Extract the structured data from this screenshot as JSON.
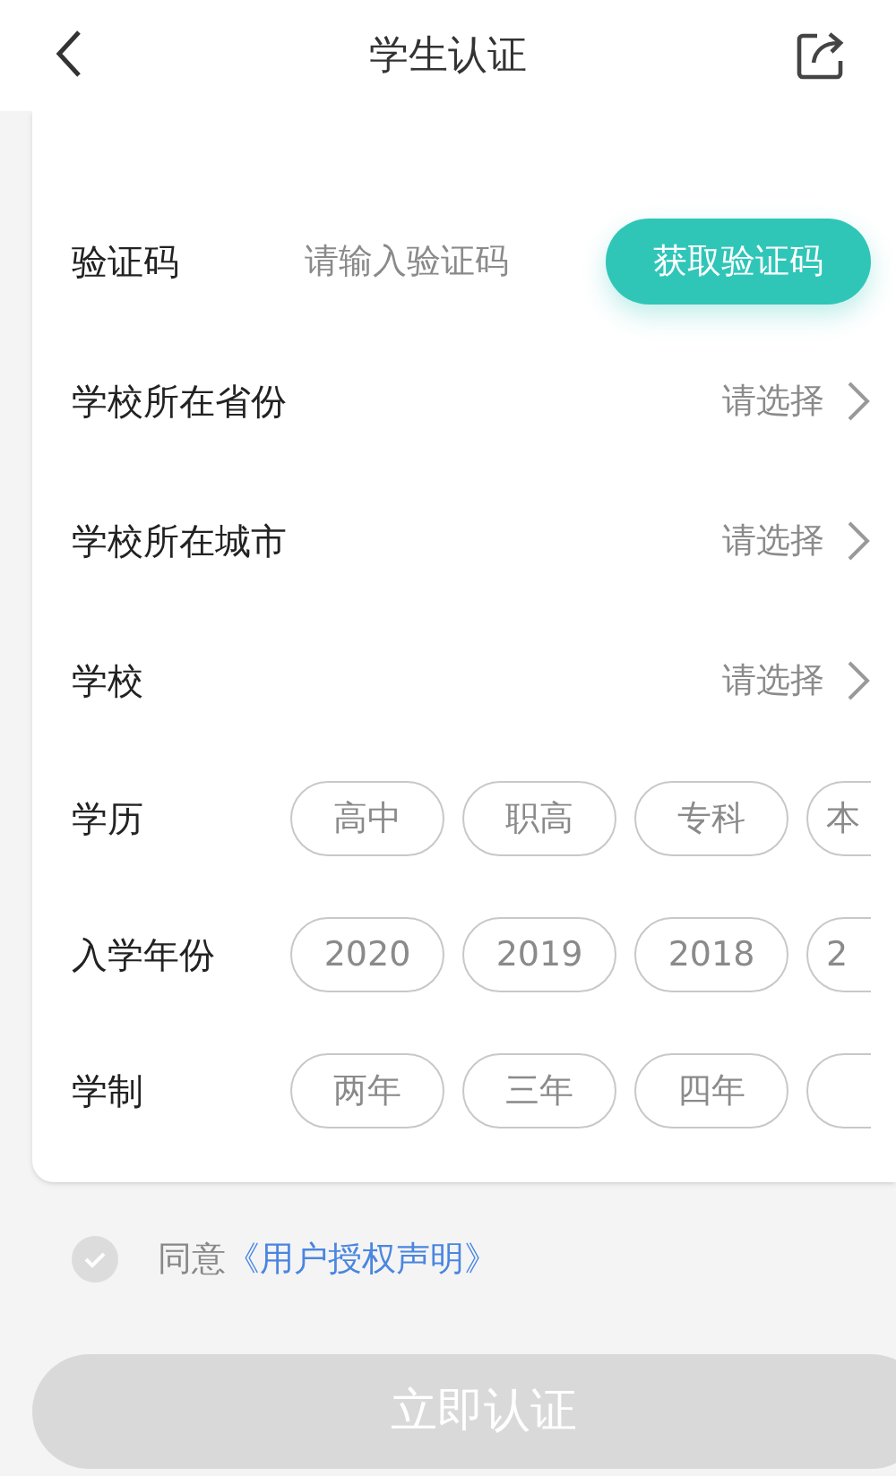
{
  "header": {
    "title": "学生认证"
  },
  "code_row": {
    "label": "验证码",
    "placeholder": "请输入验证码",
    "button": "获取验证码"
  },
  "select_rows": [
    {
      "label": "学校所在省份",
      "value": "请选择"
    },
    {
      "label": "学校所在城市",
      "value": "请选择"
    },
    {
      "label": "学校",
      "value": "请选择"
    }
  ],
  "chip_rows": [
    {
      "label": "学历",
      "options": [
        {
          "label": "高中",
          "selected": false
        },
        {
          "label": "职高",
          "selected": false
        },
        {
          "label": "专科",
          "selected": false
        },
        {
          "label": "本",
          "selected": false
        }
      ]
    },
    {
      "label": "入学年份",
      "options": [
        {
          "label": "2020",
          "selected": false
        },
        {
          "label": "2019",
          "selected": false
        },
        {
          "label": "2018",
          "selected": false
        },
        {
          "label": "2",
          "selected": false
        }
      ]
    },
    {
      "label": "学制",
      "options": [
        {
          "label": "两年",
          "selected": false
        },
        {
          "label": "三年",
          "selected": false
        },
        {
          "label": "四年",
          "selected": false
        },
        {
          "selected": false
        }
      ]
    }
  ],
  "agreement": {
    "checked": false,
    "prefix": "同意",
    "link": "《用户授权声明》"
  },
  "submit": {
    "label": "立即认证",
    "disabled": true
  }
}
